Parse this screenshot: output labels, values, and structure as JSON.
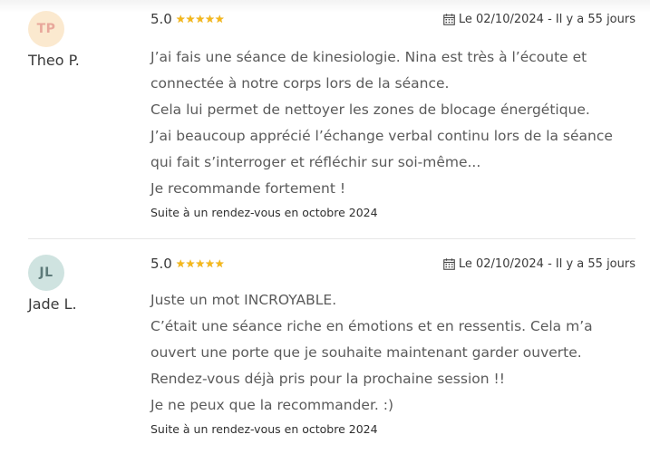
{
  "reviews": [
    {
      "initials": "TP",
      "author": "Theo P.",
      "rating": "5.0",
      "stars": 5,
      "date": "Le 02/10/2024 - Il y a 55 jours",
      "lines": [
        "J’ai fais une séance de kinesiologie. Nina est très à l’écoute et",
        "connectée à notre corps lors de la séance.",
        "Cela lui permet de nettoyer les zones de blocage énergétique.",
        "J’ai beaucoup apprécié l’échange verbal continu lors de la séance",
        "qui fait s’interroger et réfléchir sur soi-même...",
        "Je recommande fortement !"
      ],
      "context": "Suite à un rendez-vous en octobre 2024"
    },
    {
      "initials": "JL",
      "author": "Jade L.",
      "rating": "5.0",
      "stars": 5,
      "date": "Le 02/10/2024 - Il y a 55 jours",
      "lines": [
        "Juste un mot INCROYABLE.",
        "C’était une séance riche en émotions et en ressentis. Cela m’a",
        "ouvert une porte que je souhaite maintenant garder ouverte.",
        "Rendez-vous déjà pris pour la prochaine session !!",
        "Je ne peux que la recommander. :)"
      ],
      "context": "Suite à un rendez-vous en octobre 2024"
    }
  ],
  "icons": {
    "star": "star-icon",
    "calendar": "calendar-icon"
  },
  "colors": {
    "star": "#f5b81a",
    "avatar_tp": "#fbe9cf",
    "avatar_jl": "#cfe3e0"
  }
}
